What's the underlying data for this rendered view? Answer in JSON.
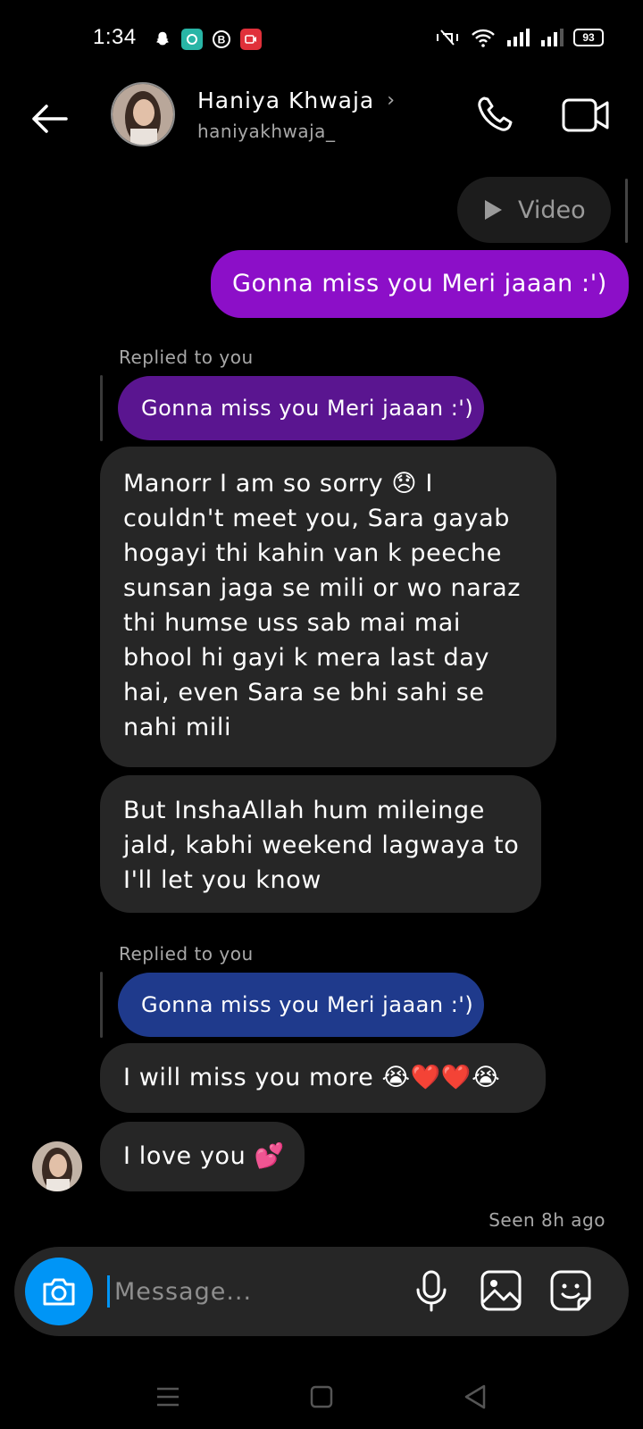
{
  "status_bar": {
    "time": "1:34",
    "battery": "93"
  },
  "header": {
    "name": "Haniya Khwaja",
    "username": "haniyakhwaja_",
    "chevron": "›"
  },
  "messages": {
    "video_label": "Video",
    "sent_1": "Gonna miss you Meri jaaan :')",
    "reply_1": {
      "label": "Replied to you",
      "quoted": "Gonna miss you Meri jaaan :')"
    },
    "received_1": "Manorr I am so sorry 😞 I couldn't meet you, Sara gayab hogayi thi kahin van k peeche sunsan jaga se mili or wo naraz thi humse uss sab mai mai bhool hi gayi k mera last day hai, even Sara se bhi sahi se nahi mili",
    "received_2": "But InshaAllah hum mileinge jald, kabhi weekend lagwaya to I'll let you know",
    "reply_2": {
      "label": "Replied to you",
      "quoted": "Gonna miss you Meri jaaan :')"
    },
    "received_3": "I will miss you more 😭❤️❤️😭",
    "received_4": "I love you 💕",
    "seen": "Seen 8h ago"
  },
  "composer": {
    "placeholder": "Message..."
  },
  "colors": {
    "accent_blue": "#0095f6",
    "sent_bubble": "#8c0fc8",
    "reply_quote_purple": "#5a1590",
    "reply_quote_blue": "#1f3a8c",
    "received_bubble": "#262626"
  }
}
